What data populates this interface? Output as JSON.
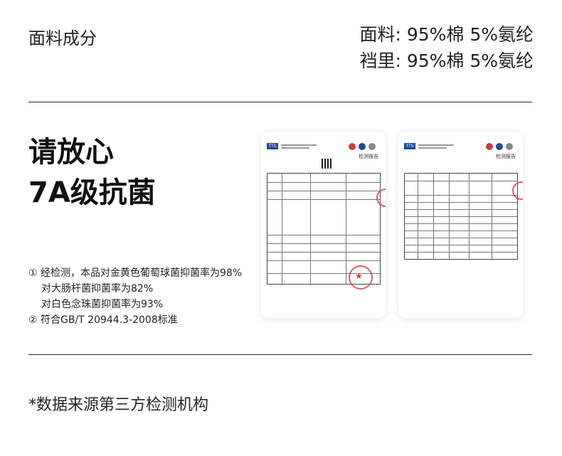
{
  "fabric": {
    "label": "面料成分",
    "line1": "面料: 95%棉  5%氨纶",
    "line2": "裆里: 95%棉  5%氨纶"
  },
  "headline": {
    "line1": "请放心",
    "line2": "7A级抗菌"
  },
  "notes": {
    "line1": "① 经检测，本品对金黄色葡萄球菌抑菌率为98%",
    "line2": "对大肠杆菌抑菌率为82%",
    "line3": "对白色念珠菌抑菌率为93%",
    "line4": "② 符合GB/T 20944.3-2008标准"
  },
  "reports": {
    "r1_title": "检测报告",
    "r2_title": "检测报告",
    "logo_text": "TTS"
  },
  "source_note": "*数据来源第三方检测机构",
  "colors": {
    "text": "#222222",
    "stamp": "#d23b3b",
    "logo": "#1f4b99"
  }
}
